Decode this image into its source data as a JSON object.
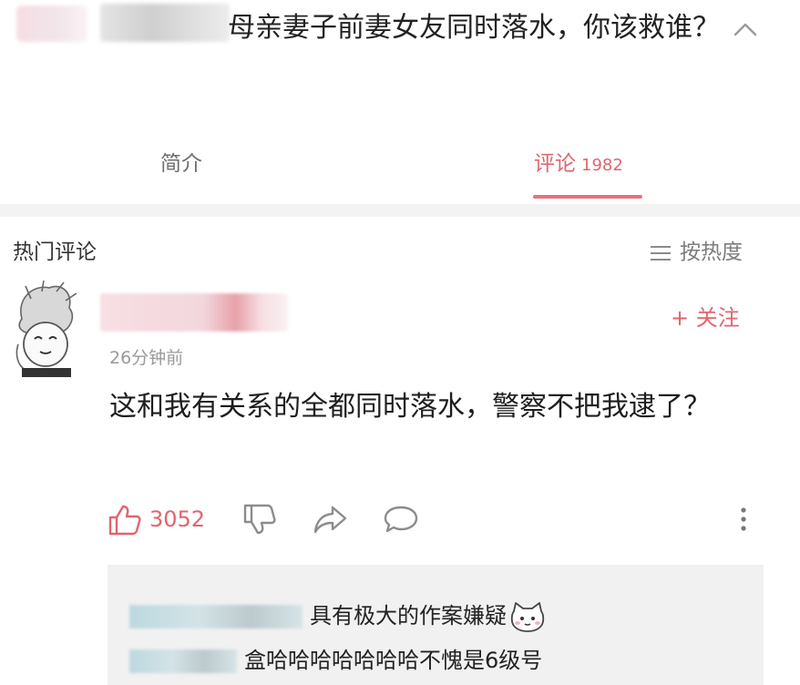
{
  "post": {
    "title": "母亲妻子前妻女友同时落水，你该救谁？"
  },
  "tabs": [
    {
      "label": "简介"
    },
    {
      "label": "评论",
      "count": "1982"
    }
  ],
  "comments_header": {
    "title": "热门评论",
    "sort_label": "按热度"
  },
  "comment": {
    "follow_label": "+ 关注",
    "time": "26分钟前",
    "content": "这和我有关系的全都同时落水，警察不把我逮了？",
    "likes": "3052"
  },
  "replies": [
    {
      "text": "具有极大的作案嫌疑"
    },
    {
      "text": "盒哈哈哈哈哈哈哈不愧是6级号"
    }
  ],
  "colors": {
    "accent": "#e0656f",
    "separator": "#f3f3f3",
    "reply_bg": "#f1f1f1"
  },
  "icons": [
    "chevron-up-icon",
    "sort-lines-icon",
    "thumbs-up-icon",
    "thumbs-down-icon",
    "share-icon",
    "comment-icon",
    "more-vertical-icon",
    "cat-emoji-icon"
  ]
}
